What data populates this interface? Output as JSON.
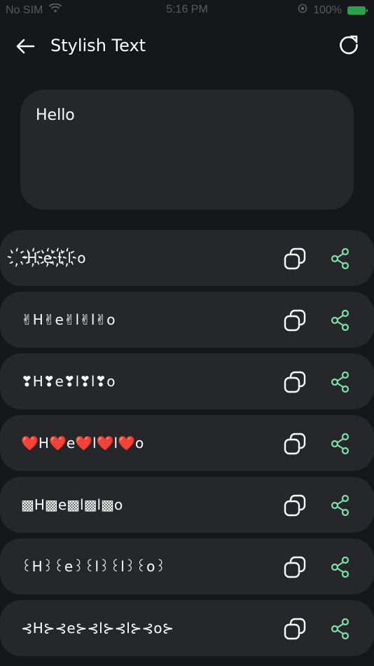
{
  "status_bar": {
    "carrier": "No SIM",
    "time": "5:16 PM",
    "battery": "100%"
  },
  "header": {
    "title": "Stylish Text",
    "back_icon": "arrow-left-icon",
    "refresh_icon": "refresh-icon"
  },
  "input": {
    "value": "Hello"
  },
  "accent_color": "#7ee2a8",
  "styles": [
    {
      "text": "҉H҉e҉l҉l҉o"
    },
    {
      "text": "✌H✌e✌l✌l✌o"
    },
    {
      "text": "❣H❣e❣l❣l❣o"
    },
    {
      "text": "❤️H❤️e❤️l❤️l❤️o"
    },
    {
      "text": "▩H▩e▩l▩l▩o"
    },
    {
      "text": "꒰H꒱꒰e꒱꒰l꒱꒰l꒱꒰o꒱"
    },
    {
      "text": "⊰H⊱⊰e⊱⊰l⊱⊰l⊱⊰o⊱"
    }
  ]
}
